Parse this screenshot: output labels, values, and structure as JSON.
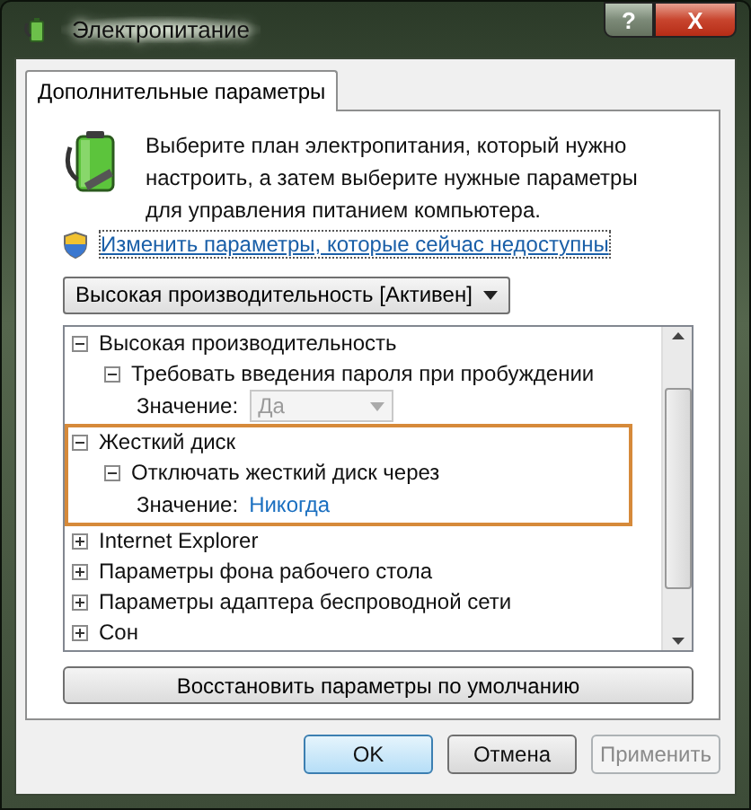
{
  "window": {
    "title": "Электропитание",
    "controls": [
      {
        "kind": "help",
        "label": "?"
      },
      {
        "kind": "close",
        "label": "X"
      }
    ]
  },
  "tabs": [
    {
      "label": "Дополнительные параметры",
      "selected": true
    }
  ],
  "intro": {
    "text": "Выберите план электропитания, который нужно настроить, а затем выберите нужные параметры для управления питанием компьютера.",
    "link": "Изменить параметры, которые сейчас недоступны"
  },
  "plan_select": {
    "value": "Высокая производительность [Активен]"
  },
  "tree": [
    {
      "label": "Высокая производительность",
      "expanded": true,
      "highlighted": false,
      "children": [
        {
          "label": "Требовать введения пароля при пробуждении",
          "expanded": true,
          "highlighted": false,
          "setting": {
            "label": "Значение:",
            "value": "Да",
            "kind": "dropdown",
            "disabled": true
          }
        }
      ]
    },
    {
      "label": "Жесткий диск",
      "expanded": true,
      "highlighted": true,
      "children": [
        {
          "label": "Отключать жесткий диск через",
          "expanded": true,
          "highlighted": false,
          "setting": {
            "label": "Значение:",
            "value": "Никогда",
            "kind": "link",
            "disabled": false
          }
        }
      ]
    },
    {
      "label": "Internet Explorer",
      "expanded": false,
      "highlighted": false
    },
    {
      "label": "Параметры фона рабочего стола",
      "expanded": false,
      "highlighted": false
    },
    {
      "label": "Параметры адаптера беспроводной сети",
      "expanded": false,
      "highlighted": false
    },
    {
      "label": "Сон",
      "expanded": false,
      "highlighted": false
    }
  ],
  "restore_button": "Восстановить параметры по умолчанию",
  "buttons": [
    {
      "label": "OK",
      "default": true,
      "disabled": false
    },
    {
      "label": "Отмена",
      "default": false,
      "disabled": false
    },
    {
      "label": "Применить",
      "default": false,
      "disabled": true
    }
  ]
}
